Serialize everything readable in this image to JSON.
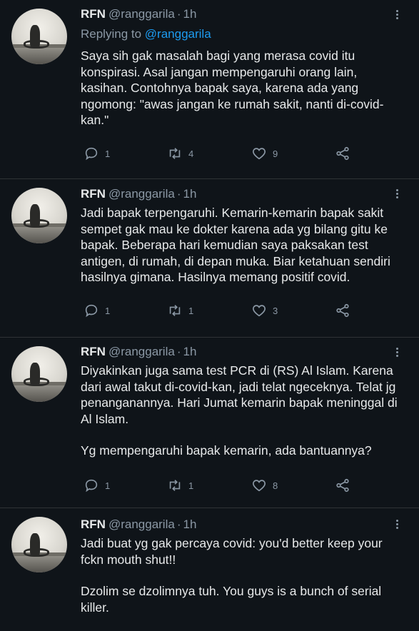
{
  "tweets": [
    {
      "name": "RFN",
      "handle": "@ranggarila",
      "dot": "·",
      "time": "1h",
      "replying_prefix": "Replying to",
      "replying_to": "@ranggarila",
      "paragraphs": [
        "Saya sih gak masalah bagi yang merasa covid itu konspirasi. Asal jangan mempengaruhi orang lain, kasihan. Contohnya bapak saya, karena ada yang ngomong: \"awas jangan ke rumah sakit, nanti di-covid-kan.\""
      ],
      "replies": "1",
      "retweets": "4",
      "likes": "9"
    },
    {
      "name": "RFN",
      "handle": "@ranggarila",
      "dot": "·",
      "time": "1h",
      "paragraphs": [
        "Jadi bapak terpengaruhi. Kemarin-kemarin bapak sakit sempet gak mau ke dokter karena ada yg bilang gitu ke bapak. Beberapa hari kemudian saya paksakan test antigen, di rumah, di depan muka. Biar ketahuan sendiri hasilnya gimana. Hasilnya memang positif covid."
      ],
      "replies": "1",
      "retweets": "1",
      "likes": "3"
    },
    {
      "name": "RFN",
      "handle": "@ranggarila",
      "dot": "·",
      "time": "1h",
      "paragraphs": [
        "Diyakinkan juga sama test PCR di (RS) Al Islam. Karena dari awal takut di-covid-kan, jadi telat ngeceknya. Telat jg penanganannya. Hari Jumat kemarin bapak meninggal di Al Islam.",
        "Yg mempengaruhi bapak kemarin, ada bantuannya?"
      ],
      "replies": "1",
      "retweets": "1",
      "likes": "8"
    },
    {
      "name": "RFN",
      "handle": "@ranggarila",
      "dot": "·",
      "time": "1h",
      "paragraphs": [
        "Jadi buat yg gak percaya covid: you'd better keep your fckn mouth shut!!",
        "Dzolim se dzolimnya tuh. You guys is a bunch of serial killer."
      ]
    }
  ],
  "icons": {
    "reply": "reply-icon",
    "retweet": "retweet-icon",
    "like": "heart-icon",
    "share": "share-icon",
    "more": "more-vertical-icon"
  },
  "colors": {
    "background": "#0f1419",
    "text": "#e7e9ea",
    "secondary": "#8b98a5",
    "link": "#1d9bf0",
    "divider": "#2f3336"
  }
}
